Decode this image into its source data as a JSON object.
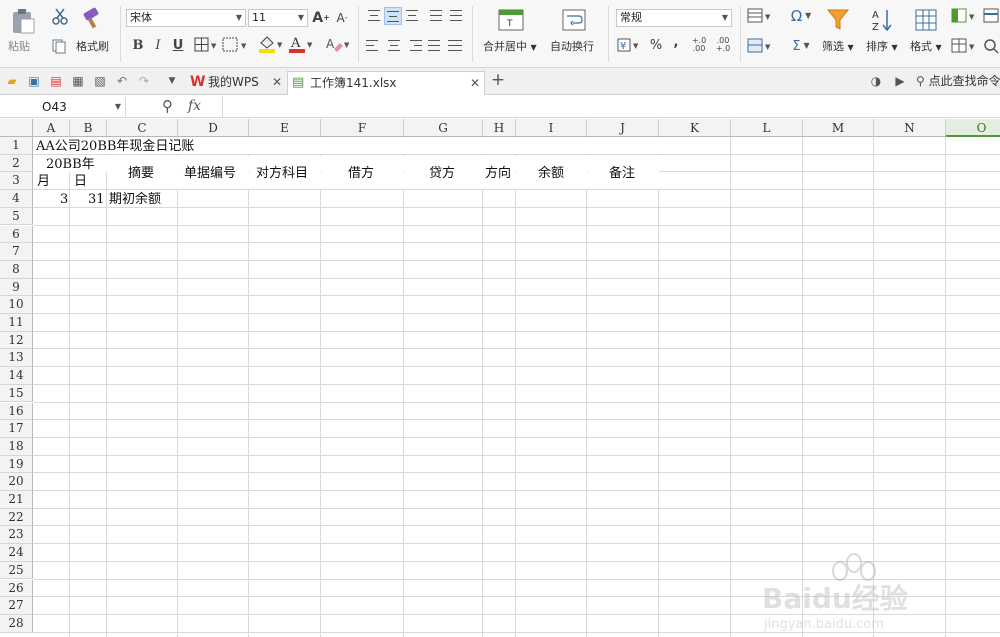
{
  "ribbon": {
    "paste_label": "粘贴",
    "cut_icon": "scissors-icon",
    "format_painter_label": "格式刷",
    "font_name": "宋体",
    "font_size": "11",
    "merge_label": "合并居中",
    "wrap_label": "自动换行",
    "number_format": "常规",
    "filter_label": "筛选",
    "sort_label": "排序",
    "format_label": "格式",
    "sum_symbol": "Σ",
    "percent_symbol": "%",
    "comma_symbol": ",",
    "decimal_inc": "+.0 .00",
    "decimal_dec": ".00 +.0"
  },
  "tabs": {
    "home_tab_label": "我的WPS",
    "doc_tab_label": "工作簿141.xlsx",
    "search_label": "点此查找命令"
  },
  "formula_bar": {
    "name_box": "O43",
    "fx_label": "fx",
    "formula": ""
  },
  "sheet": {
    "columns": [
      "A",
      "B",
      "C",
      "D",
      "E",
      "F",
      "G",
      "H",
      "I",
      "J",
      "K",
      "L",
      "M",
      "N",
      "O"
    ],
    "rows": [
      "1",
      "2",
      "3",
      "4",
      "5",
      "6",
      "7",
      "8",
      "9",
      "10",
      "11",
      "12",
      "13",
      "14",
      "15",
      "16",
      "17",
      "18",
      "19",
      "20",
      "21",
      "22",
      "23",
      "24",
      "25",
      "26",
      "27",
      "28"
    ],
    "title": "AA公司20BB年现金日记账",
    "year_header": "20BB年",
    "month_header": "月",
    "day_header": "日",
    "headers": {
      "summary": "摘要",
      "doc_no": "单据编号",
      "account": "对方科目",
      "debit": "借方",
      "credit": "贷方",
      "direction": "方向",
      "balance": "余额",
      "note": "备注"
    },
    "row4": {
      "month": "3",
      "day": "31",
      "summary": "期初余额"
    }
  },
  "watermark": {
    "brand": "Baidu经验",
    "url": "jingyan.baidu.com"
  },
  "colors": {
    "accent_green": "#4d9a3a",
    "wps_red": "#d9322c",
    "grid_line": "#d9d9d9",
    "header_bg": "#f3f3f3"
  }
}
